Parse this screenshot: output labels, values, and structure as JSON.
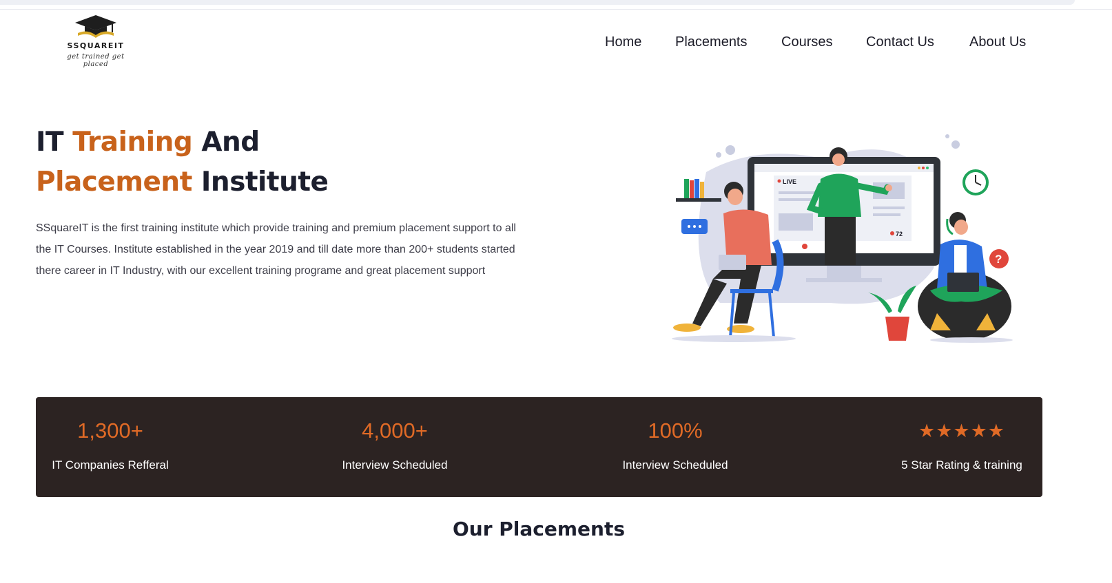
{
  "brand": {
    "name": "SSQUAREIT",
    "tagline": "get trained get placed"
  },
  "nav": {
    "items": [
      "Home",
      "Placements",
      "Courses",
      "Contact Us",
      "About Us"
    ]
  },
  "hero": {
    "title_part1": "IT ",
    "title_accent1": "Training",
    "title_part2": " And",
    "title_accent2": "Placement",
    "title_part3": " Institute",
    "description": "SSquareIT is the first training institute which provide training and premium placement support to all the IT Courses. Institute established in the year 2019 and till date more than 200+ students started there career in IT Industry, with our excellent training programe and great placement support",
    "illustration": {
      "live_label": "LIVE",
      "viewer_count": "72"
    }
  },
  "stats": [
    {
      "value": "1,300+",
      "label": "IT Companies Refferal"
    },
    {
      "value": "4,000+",
      "label": "Interview Scheduled"
    },
    {
      "value": "100%",
      "label": "Interview Scheduled"
    },
    {
      "value": "★★★★★",
      "label": "5 Star Rating & training",
      "stars": 5
    }
  ],
  "sections": {
    "placements_title": "Our Placements"
  },
  "colors": {
    "accent": "#c8621b",
    "stat_accent": "#e06a26",
    "stats_bg": "#2c2322",
    "heading": "#1c1f2e"
  }
}
